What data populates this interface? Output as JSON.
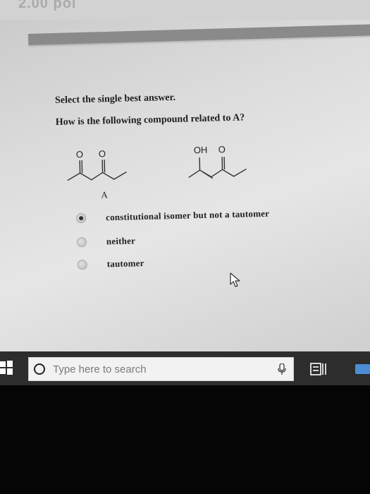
{
  "top_banner": {
    "text": "2.00 poi"
  },
  "question": {
    "instruction": "Select the single best answer.",
    "prompt": "How is the following compound related to A?",
    "molecule_labels": {
      "a_o1": "O",
      "a_o2": "O",
      "a_name": "A",
      "b_oh": "OH",
      "b_o": "O"
    },
    "options": [
      {
        "label": "constitutional isomer but not a tautomer",
        "selected": true
      },
      {
        "label": "neither",
        "selected": false
      },
      {
        "label": "tautomer",
        "selected": false
      }
    ]
  },
  "taskbar": {
    "search_placeholder": "Type here to search",
    "icons": [
      "windows-start-icon",
      "search-icon",
      "microphone-icon",
      "task-view-icon",
      "app-icon"
    ]
  },
  "colors": {
    "taskbar": "#2d2d2d",
    "search_box": "#f2f2f2",
    "app_icon": "#4a8fd6"
  }
}
